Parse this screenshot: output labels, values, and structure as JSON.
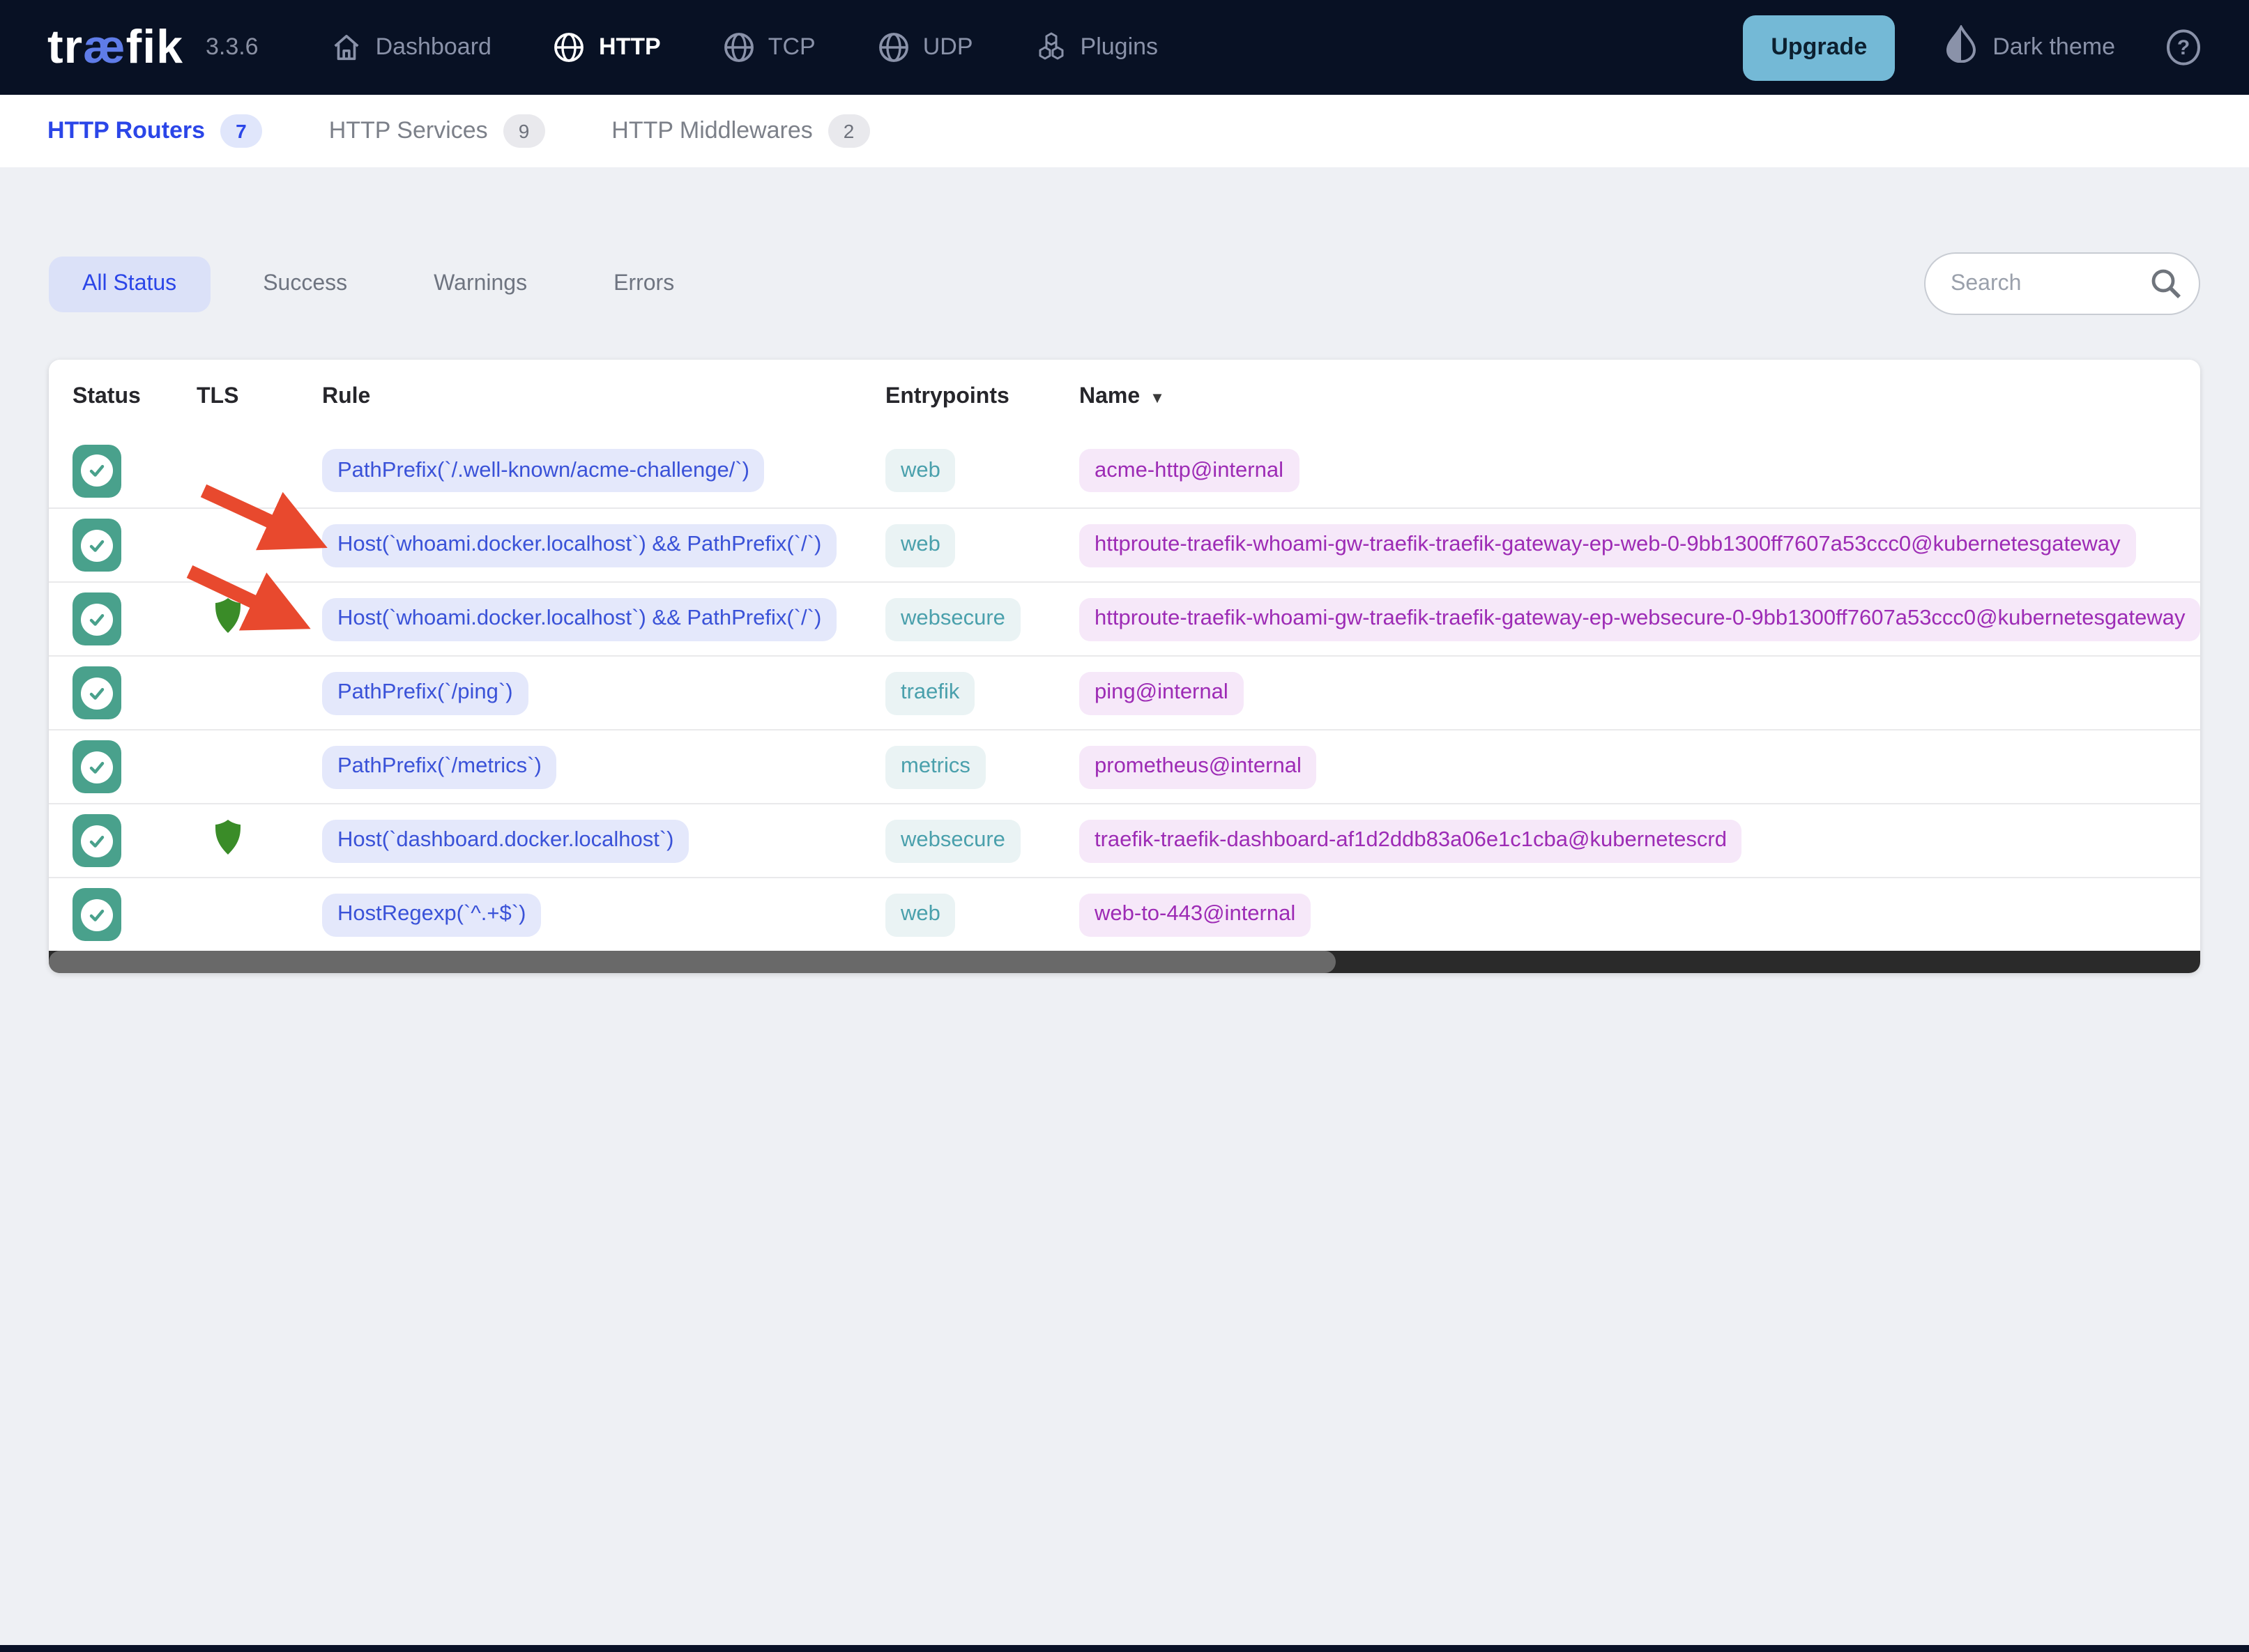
{
  "navbar": {
    "logo": {
      "part1": "tr",
      "part2": "æ",
      "part3": "fik"
    },
    "version": "3.3.6",
    "items": [
      {
        "label": "Dashboard",
        "icon": "home-icon",
        "active": false
      },
      {
        "label": "HTTP",
        "icon": "globe-icon",
        "active": true
      },
      {
        "label": "TCP",
        "icon": "globe-icon",
        "active": false
      },
      {
        "label": "UDP",
        "icon": "globe-icon",
        "active": false
      },
      {
        "label": "Plugins",
        "icon": "cubes-icon",
        "active": false
      }
    ],
    "upgrade_label": "Upgrade",
    "theme_toggle_label": "Dark theme"
  },
  "section_tabs": [
    {
      "label": "HTTP Routers",
      "count": "7",
      "active": true
    },
    {
      "label": "HTTP Services",
      "count": "9",
      "active": false
    },
    {
      "label": "HTTP Middlewares",
      "count": "2",
      "active": false
    }
  ],
  "filters": [
    {
      "label": "All Status",
      "active": true
    },
    {
      "label": "Success",
      "active": false
    },
    {
      "label": "Warnings",
      "active": false
    },
    {
      "label": "Errors",
      "active": false
    }
  ],
  "search": {
    "placeholder": "Search"
  },
  "table": {
    "columns": [
      "Status",
      "TLS",
      "Rule",
      "Entrypoints",
      "Name"
    ],
    "sorted_column": "Name",
    "rows": [
      {
        "status": "enabled",
        "tls": false,
        "rule": "PathPrefix(`/.well-known/acme-challenge/`)",
        "entrypoint": "web",
        "name": "acme-http@internal"
      },
      {
        "status": "enabled",
        "tls": false,
        "rule": "Host(`whoami.docker.localhost`) && PathPrefix(`/`)",
        "entrypoint": "web",
        "name": "httproute-traefik-whoami-gw-traefik-traefik-gateway-ep-web-0-9bb1300ff7607a53ccc0@kubernetesgateway"
      },
      {
        "status": "enabled",
        "tls": true,
        "rule": "Host(`whoami.docker.localhost`) && PathPrefix(`/`)",
        "entrypoint": "websecure",
        "name": "httproute-traefik-whoami-gw-traefik-traefik-gateway-ep-websecure-0-9bb1300ff7607a53ccc0@kubernetesgateway"
      },
      {
        "status": "enabled",
        "tls": false,
        "rule": "PathPrefix(`/ping`)",
        "entrypoint": "traefik",
        "name": "ping@internal"
      },
      {
        "status": "enabled",
        "tls": false,
        "rule": "PathPrefix(`/metrics`)",
        "entrypoint": "metrics",
        "name": "prometheus@internal"
      },
      {
        "status": "enabled",
        "tls": true,
        "rule": "Host(`dashboard.docker.localhost`)",
        "entrypoint": "websecure",
        "name": "traefik-traefik-dashboard-af1d2ddb83a06e1c1cba@kubernetescrd"
      },
      {
        "status": "enabled",
        "tls": false,
        "rule": "HostRegexp(`^.+$`)",
        "entrypoint": "web",
        "name": "web-to-443@internal"
      }
    ]
  },
  "colors": {
    "navbar_bg": "#081124",
    "accent_blue": "#2b46e8",
    "rule_text": "#3a52d8",
    "rule_bg": "#e4e8fb",
    "entrypoint_text": "#4aa0ac",
    "entrypoint_bg": "#eaf3f4",
    "name_text": "#9d2bb5",
    "name_bg": "#f6e8f9",
    "status_teal": "#49a18c",
    "tls_shield_green": "#3a8c28",
    "upgrade_bg": "#74b9d6",
    "annotation_arrow_red": "#e8492e",
    "page_bg": "#eef0f4"
  }
}
